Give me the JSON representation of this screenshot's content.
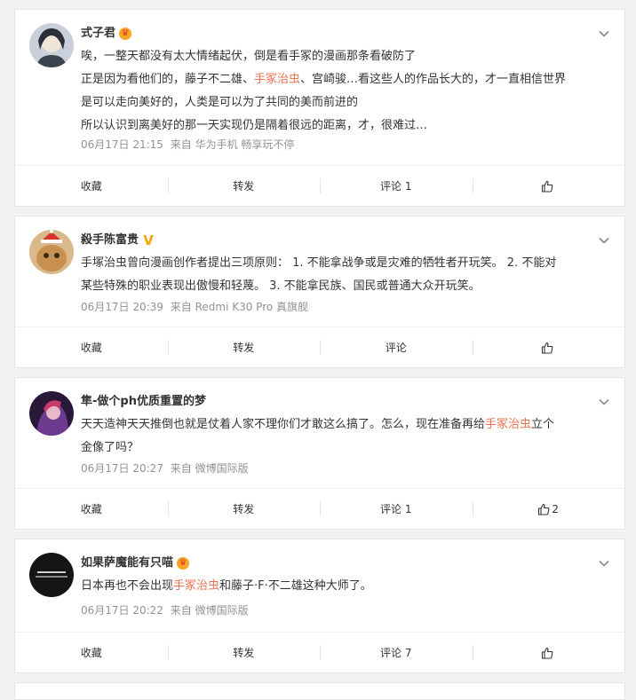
{
  "posts": [
    {
      "username": "式子君",
      "badge": "crown",
      "paragraphs": [
        [
          {
            "t": "唉，一整天都没有太大情绪起伏，倒是看手冢的漫画那条看破防了"
          }
        ],
        [
          {
            "t": "正是因为看他们的，藤子不二雄、"
          },
          {
            "t": "手冢治虫",
            "hl": true
          },
          {
            "t": "、宫崎骏…看这些人的作品长大的，才一直相信世界"
          }
        ],
        [
          {
            "t": "是可以走向美好的，人类是可以为了共同的美而前进的"
          }
        ],
        [
          {
            "t": "所以认识到离美好的那一天实现仍是隔着很远的距离，才，很难过…"
          }
        ]
      ],
      "time": "06月17日 21:15",
      "source": "来自 华为手机 畅享玩不停",
      "actions": {
        "favorite": "收藏",
        "repost": "转发",
        "comment": "评论 1",
        "like_count": ""
      }
    },
    {
      "username": "殺手陈富贵",
      "badge": "vip",
      "paragraphs": [
        [
          {
            "t": "手塚治虫曾向漫画创作者提出三项原则： 1. 不能拿战争或是灾难的牺牲者开玩笑。 2. 不能对"
          }
        ],
        [
          {
            "t": "某些特殊的职业表现出傲慢和轻蔑。 3. 不能拿民族、国民或普通大众开玩笑。"
          }
        ]
      ],
      "time": "06月17日 20:39",
      "source": "来自 Redmi K30 Pro 真旗舰",
      "actions": {
        "favorite": "收藏",
        "repost": "转发",
        "comment": "评论",
        "like_count": ""
      }
    },
    {
      "username": "隼-做个ph优质重置的梦",
      "badge": "",
      "paragraphs": [
        [
          {
            "t": "天天造神天天推倒也就是仗着人家不理你们才敢这么搞了。怎么，现在准备再给"
          },
          {
            "t": "手冢治虫",
            "hl": true
          },
          {
            "t": "立个"
          }
        ],
        [
          {
            "t": "金像了吗？"
          }
        ]
      ],
      "time": "06月17日 20:27",
      "source": "来自 微博国际版",
      "actions": {
        "favorite": "收藏",
        "repost": "转发",
        "comment": "评论 1",
        "like_count": "2"
      }
    },
    {
      "username": "如果萨魔能有只喵",
      "badge": "crown",
      "paragraphs": [
        [
          {
            "t": "日本再也不会出现"
          },
          {
            "t": "手冢治虫",
            "hl": true
          },
          {
            "t": "和藤子·F·不二雄这种大师了。"
          }
        ]
      ],
      "time": "06月17日 20:22",
      "source": "来自 微博国际版",
      "actions": {
        "favorite": "收藏",
        "repost": "转发",
        "comment": "评论 7",
        "like_count": ""
      }
    }
  ],
  "icons": {
    "more": "chevron-down-icon",
    "like": "thumbs-up-icon",
    "badge_crown": "crown-badge-icon",
    "badge_vip": "vip-badge-icon"
  },
  "colors": {
    "highlight": "#eb7350",
    "meta": "#939393",
    "vip": "#f5a500"
  }
}
